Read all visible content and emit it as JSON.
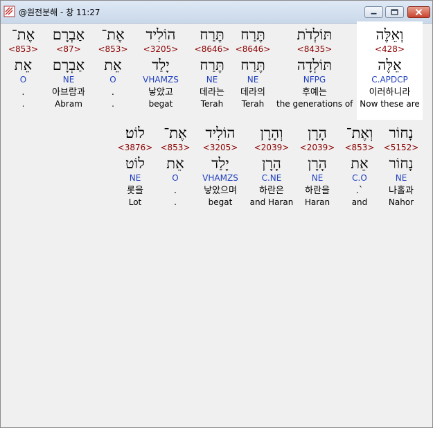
{
  "window": {
    "title": "@원전분해 - 창 11:27"
  },
  "colors": {
    "strong": "#8b0000",
    "morph": "#1f3fbf",
    "highlight": "#ffffff"
  },
  "rows": [
    [
      {
        "heb": "אֶת־",
        "strong": "<853>",
        "root": "אֵת",
        "morph": "O",
        "kor": ".",
        "eng": "."
      },
      {
        "heb": "אַבְרָם",
        "strong": "<87>",
        "root": "אַבְרָם",
        "morph": "NE",
        "kor": "아브람과",
        "eng": "Abram"
      },
      {
        "heb": "אֶת־",
        "strong": "<853>",
        "root": "אֵת",
        "morph": "O",
        "kor": ".",
        "eng": "."
      },
      {
        "heb": "הוֹלִיד",
        "strong": "<3205>",
        "root": "יָלַד",
        "morph": "VHAMZS",
        "kor": "낳았고",
        "eng": "begat"
      },
      {
        "heb": "תֶּרַח",
        "strong": "<8646>",
        "root": "תֶּרַח",
        "morph": "NE",
        "kor": "데라는",
        "eng": "Terah"
      },
      {
        "heb": "תֶּרַח",
        "strong": "<8646>",
        "root": "תֶּרַח",
        "morph": "NE",
        "kor": "데라의",
        "eng": "Terah"
      },
      {
        "heb": "תּוֹלְדֹת",
        "strong": "<8435>",
        "root": "תּוֹלְדָה",
        "morph": "NFPG",
        "kor": "후예는",
        "eng": "the generations of"
      },
      {
        "heb": "וְאֵלֶּה",
        "strong": "<428>",
        "root": "אֵלֶּה",
        "morph": "C.APDCP",
        "kor": "이러하니라",
        "eng": "Now these are"
      }
    ],
    [
      {
        "heb": "לוֹט׃",
        "strong": "<3876>",
        "root": "לוֹט",
        "morph": "NE",
        "kor": "롯을",
        "eng": "Lot"
      },
      {
        "heb": "אֶת־",
        "strong": "<853>",
        "root": "אֵת",
        "morph": "O",
        "kor": ".",
        "eng": "."
      },
      {
        "heb": "הוֹלִיד",
        "strong": "<3205>",
        "root": "יָלַד",
        "morph": "VHAMZS",
        "kor": "낳았으며",
        "eng": "begat"
      },
      {
        "heb": "וְהָרָן",
        "strong": "<2039>",
        "root": "הָרָן",
        "morph": "C.NE",
        "kor": "하란은",
        "eng": "and Haran"
      },
      {
        "heb": "הָרָן",
        "strong": "<2039>",
        "root": "הָרָן",
        "morph": "NE",
        "kor": "하란을",
        "eng": "Haran"
      },
      {
        "heb": "וְאֶת־",
        "strong": "<853>",
        "root": "אֵת",
        "morph": "C.O",
        "kor": ".`",
        "eng": "and"
      },
      {
        "heb": "נָחוֹר",
        "strong": "<5152>",
        "root": "נָחוֹר",
        "morph": "NE",
        "kor": "나홀과",
        "eng": "Nahor"
      }
    ]
  ]
}
